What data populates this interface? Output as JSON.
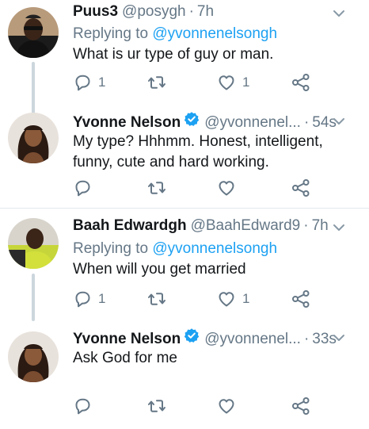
{
  "tweets": [
    {
      "name": "Puus3",
      "handle": "@posygh",
      "time": "7h",
      "replying_label": "Replying to",
      "replying_to": "@yvonnenelsongh",
      "text": "What is ur type of guy or man.",
      "verified": false,
      "replies": "1",
      "retweets": "",
      "likes": "1"
    },
    {
      "name": "Yvonne Nelson",
      "handle": "@yvonnenel...",
      "time": "54s",
      "text": "My type? Hhhmm. Honest, intelligent, funny, cute and hard working.",
      "verified": true,
      "replies": "",
      "retweets": "",
      "likes": ""
    },
    {
      "name": "Baah Edwardgh",
      "handle": "@BaahEdward9",
      "time": "7h",
      "replying_label": "Replying to",
      "replying_to": "@yvonnenelsongh",
      "text": "When will you get married",
      "verified": false,
      "replies": "1",
      "retweets": "",
      "likes": "1"
    },
    {
      "name": "Yvonne Nelson",
      "handle": "@yvonnenel...",
      "time": "33s",
      "text": "Ask God for me",
      "verified": true,
      "replies": "",
      "retweets": "",
      "likes": ""
    }
  ],
  "separator": "·",
  "icons": {
    "reply": "reply-icon",
    "retweet": "retweet-icon",
    "like": "heart-icon",
    "share": "share-icon",
    "menu": "chevron-down-icon",
    "verified": "verified-badge-icon"
  },
  "colors": {
    "link": "#1da1f2",
    "secondary_text": "#657786",
    "primary_text": "#14171a",
    "thread_line": "#ccd6dd",
    "divider": "#e1e8ed",
    "verified": "#1da1f2"
  }
}
